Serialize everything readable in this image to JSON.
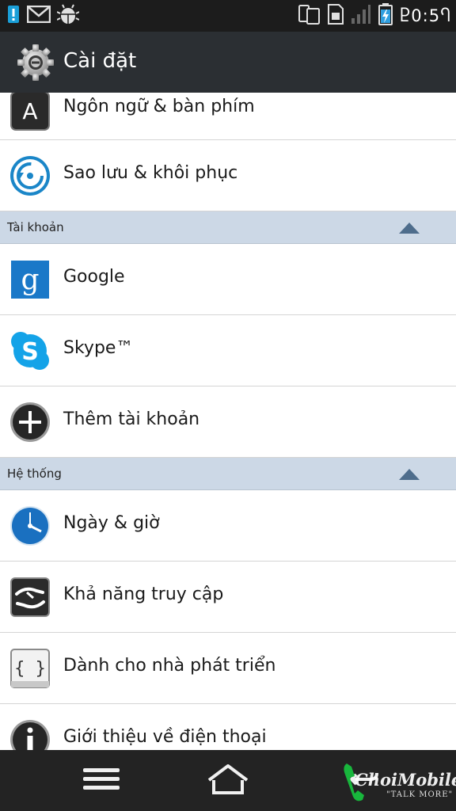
{
  "status_bar": {
    "clock": "Ⴒ0:5Ⴄ",
    "left_icons": [
      "warning-icon",
      "gmail-icon",
      "android-debug-icon"
    ],
    "right_icons": [
      "phone-tablet-icon",
      "sim-card-icon",
      "signal-icon",
      "battery-charging-icon"
    ]
  },
  "action_bar": {
    "title": "Cài đặt",
    "icon": "settings-gear-icon"
  },
  "list": {
    "items_top": [
      {
        "label": "Ngôn ngữ & bàn phím",
        "icon": "language-keyboard-icon"
      },
      {
        "label": "Sao lưu & khôi phục",
        "icon": "backup-restore-icon"
      }
    ],
    "section_accounts": {
      "label": "Tài khoản"
    },
    "accounts": [
      {
        "label": "Google",
        "icon": "google-icon"
      },
      {
        "label": "Skype™",
        "icon": "skype-icon"
      },
      {
        "label": "Thêm tài khoản",
        "icon": "add-account-icon"
      }
    ],
    "section_system": {
      "label": "Hệ thống"
    },
    "system": [
      {
        "label": "Ngày & giờ",
        "icon": "clock-icon"
      },
      {
        "label": "Khả năng truy cập",
        "icon": "accessibility-icon"
      },
      {
        "label": "Dành cho nhà phát triển",
        "icon": "developer-options-icon"
      },
      {
        "label": "Giới thiệu về điện thoại",
        "icon": "info-icon"
      }
    ]
  },
  "nav_bar": {
    "buttons": [
      "menu-icon",
      "home-icon",
      "back-icon"
    ]
  },
  "watermark": {
    "text": "ChoiMobile",
    "sub": "\"TALK MORE\""
  },
  "colors": {
    "status_bar_bg": "#1c1c1c",
    "action_bar_bg": "#2b2f33",
    "section_bg": "#ccd8e6",
    "section_triangle": "#4e6d8c",
    "divider": "#d4d4d4",
    "nav_bar_bg": "#232323"
  }
}
